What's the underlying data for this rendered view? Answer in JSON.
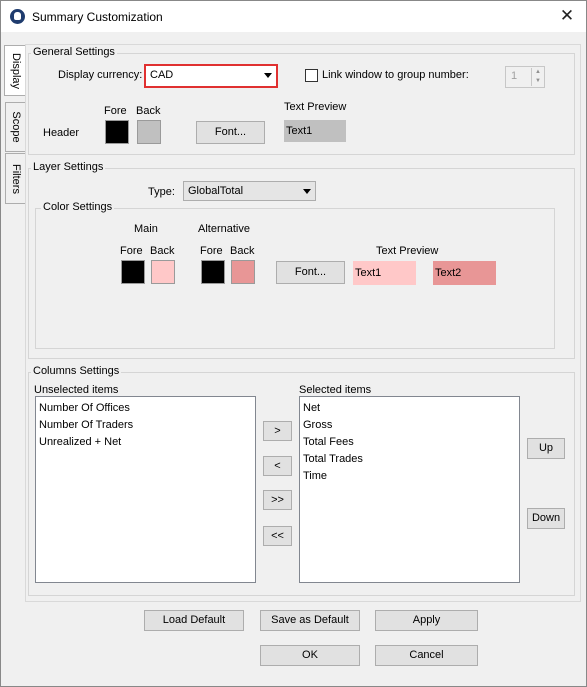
{
  "window": {
    "title": "Summary Customization"
  },
  "tabs": [
    "Display",
    "Scope",
    "Filters"
  ],
  "general": {
    "title": "General Settings",
    "currency_label": "Display currency:",
    "currency_value": "CAD",
    "link_label": "Link window to group number:",
    "link_checked": false,
    "group_number": "1",
    "fore_label": "Fore",
    "back_label": "Back",
    "header_label": "Header",
    "font_button": "Font...",
    "preview_label": "Text Preview",
    "preview_text": "Text1"
  },
  "layer": {
    "title": "Layer Settings",
    "type_label": "Type:",
    "type_value": "GlobalTotal",
    "color_settings_title": "Color Settings",
    "main_label": "Main",
    "alternative_label": "Alternative",
    "fore_label": "Fore",
    "back_label": "Back",
    "font_button": "Font...",
    "preview_label": "Text Preview",
    "preview_text1": "Text1",
    "preview_text2": "Text2"
  },
  "columns": {
    "title": "Columns Settings",
    "unselected_label": "Unselected items",
    "selected_label": "Selected items",
    "unselected_items": [
      "Number Of Offices",
      "Number Of Traders",
      "Unrealized + Net"
    ],
    "selected_items": [
      "Net",
      "Gross",
      "Total Fees",
      "Total Trades",
      "Time"
    ],
    "move_right": ">",
    "move_left": "<",
    "move_all_right": ">>",
    "move_all_left": "<<",
    "up": "Up",
    "down": "Down"
  },
  "footer": {
    "load_default": "Load Default",
    "save_default": "Save as Default",
    "apply": "Apply",
    "ok": "OK",
    "cancel": "Cancel"
  },
  "colors": {
    "header_fore": "#000000",
    "header_back": "#c0c0c0",
    "main_fore": "#000000",
    "main_back": "#ffc8c8",
    "alt_fore": "#000000",
    "alt_back": "#e89696",
    "focus_border": "#e03030"
  }
}
